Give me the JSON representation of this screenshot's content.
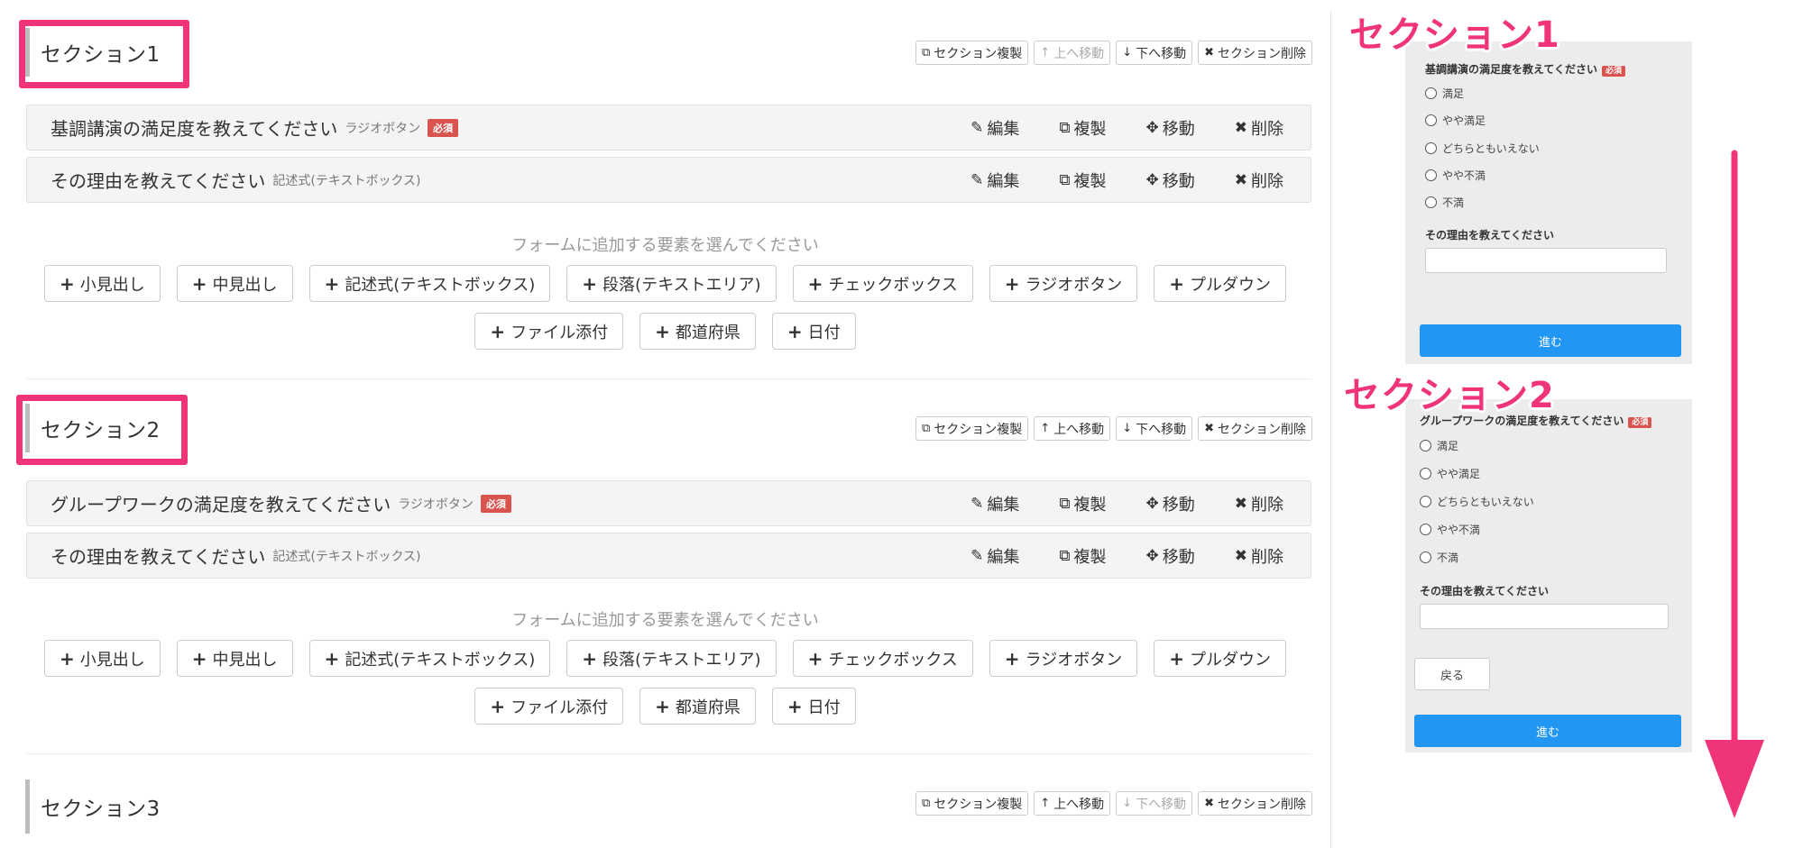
{
  "section_tools": {
    "duplicate": "セクション複製",
    "move_up": "上へ移動",
    "move_down": "下へ移動",
    "delete": "セクション削除"
  },
  "question_actions": {
    "edit": "編集",
    "duplicate": "複製",
    "move": "移動",
    "delete": "削除"
  },
  "required_badge": "必須",
  "add_prompt": "フォームに追加する要素を選んでください",
  "add_buttons": [
    "小見出し",
    "中見出し",
    "記述式(テキストボックス)",
    "段落(テキストエリア)",
    "チェックボックス",
    "ラジオボタン",
    "プルダウン",
    "ファイル添付",
    "都道府県",
    "日付"
  ],
  "sections": [
    {
      "title": "セクション1",
      "questions": [
        {
          "title": "基調講演の満足度を教えてください",
          "type": "ラジオボタン",
          "required": true
        },
        {
          "title": "その理由を教えてください",
          "type": "記述式(テキストボックス)",
          "required": false
        }
      ]
    },
    {
      "title": "セクション2",
      "questions": [
        {
          "title": "グループワークの満足度を教えてください",
          "type": "ラジオボタン",
          "required": true
        },
        {
          "title": "その理由を教えてください",
          "type": "記述式(テキストボックス)",
          "required": false
        }
      ]
    },
    {
      "title": "セクション3",
      "questions": []
    }
  ],
  "preview": {
    "annotations": [
      "セクション1",
      "セクション2"
    ],
    "panel1": {
      "question": "基調講演の満足度を教えてください",
      "options": [
        "満足",
        "やや満足",
        "どちらともいえない",
        "やや不満",
        "不満"
      ],
      "text_question": "その理由を教えてください",
      "next": "進む"
    },
    "panel2": {
      "question": "グループワークの満足度を教えてください",
      "options": [
        "満足",
        "やや満足",
        "どちらともいえない",
        "やや不満",
        "不満"
      ],
      "text_question": "その理由を教えてください",
      "back": "戻る",
      "next": "進む"
    }
  },
  "colors": {
    "highlight": "#f0347a",
    "primary_button": "#2196f3",
    "required": "#d9534f"
  }
}
